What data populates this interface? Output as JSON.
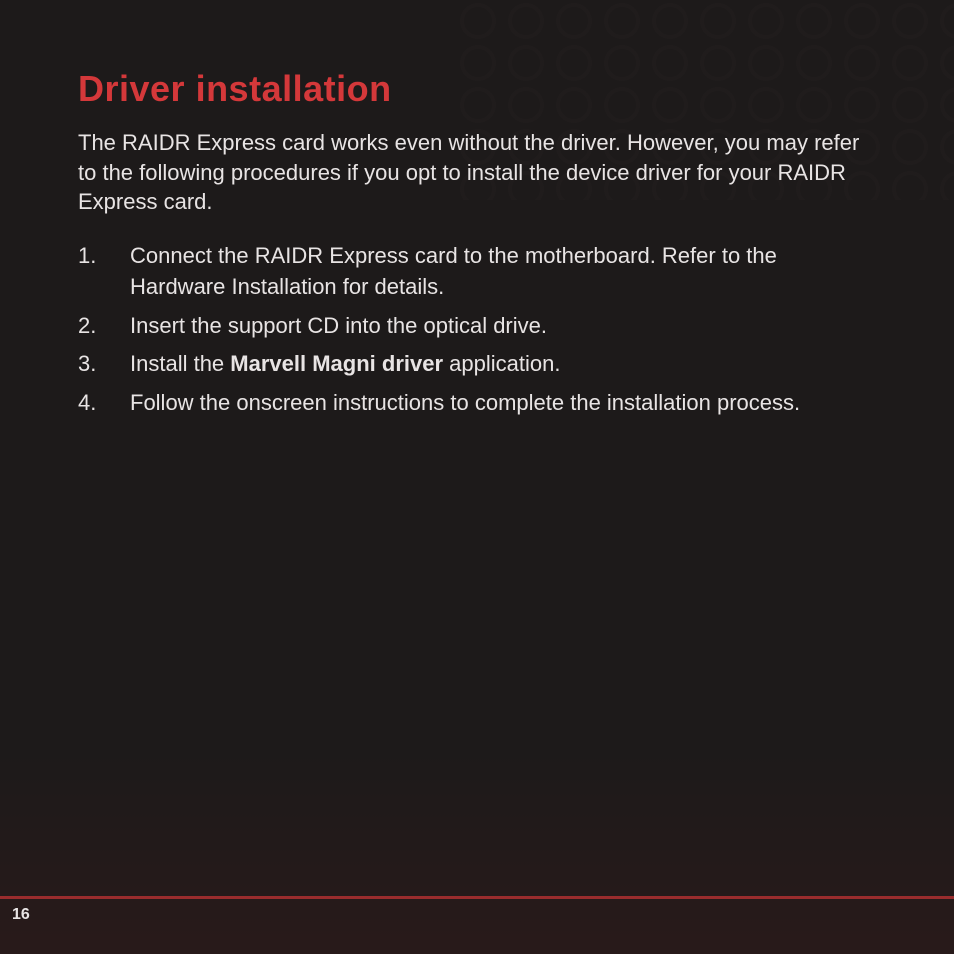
{
  "title": "Driver installation",
  "intro": "The RAIDR Express card works even without the driver. However, you may refer to the following procedures if you opt to install the device driver for your RAIDR Express card.",
  "steps": [
    {
      "num": "1.",
      "text": "Connect the RAIDR Express card to the motherboard. Refer to the Hardware Installation for details."
    },
    {
      "num": "2.",
      "text": "Insert the support CD into the optical drive."
    },
    {
      "num": "3.",
      "prefix": "Install the ",
      "bold": "Marvell Magni driver",
      "suffix": " application."
    },
    {
      "num": "4.",
      "text": "Follow the onscreen instructions to complete the installation process."
    }
  ],
  "page_number": "16"
}
